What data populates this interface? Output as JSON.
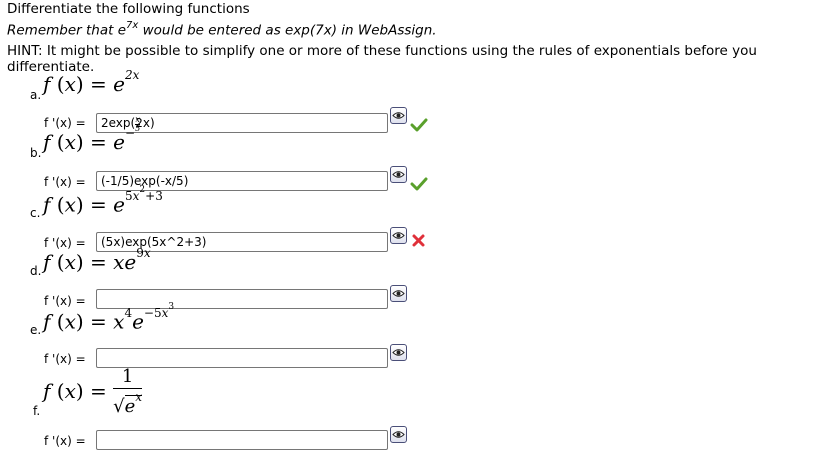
{
  "header": {
    "title": "Differentiate the following functions",
    "remember_prefix": "Remember that e",
    "remember_sup": "7x",
    "remember_suffix": " would be entered as exp(7x) in WebAssign.",
    "hint": "HINT: It might be possible to simplify one or more of these functions using the rules of exponentials before you differentiate."
  },
  "derivative_label": "f '(x) =",
  "questions": [
    {
      "letter": "a.",
      "answer": "2exp(2x)",
      "status": "correct"
    },
    {
      "letter": "b.",
      "answer": "(-1/5)exp(-x/5)",
      "status": "correct"
    },
    {
      "letter": "c.",
      "answer": "(5x)exp(5x^2+3)",
      "status": "incorrect"
    },
    {
      "letter": "d.",
      "answer": "",
      "status": "none"
    },
    {
      "letter": "e.",
      "answer": "",
      "status": "none"
    },
    {
      "letter": "f.",
      "answer": "",
      "status": "none"
    }
  ],
  "colors": {
    "correct": "#5aa02c",
    "incorrect": "#e0303a",
    "input_border": "#767676"
  }
}
